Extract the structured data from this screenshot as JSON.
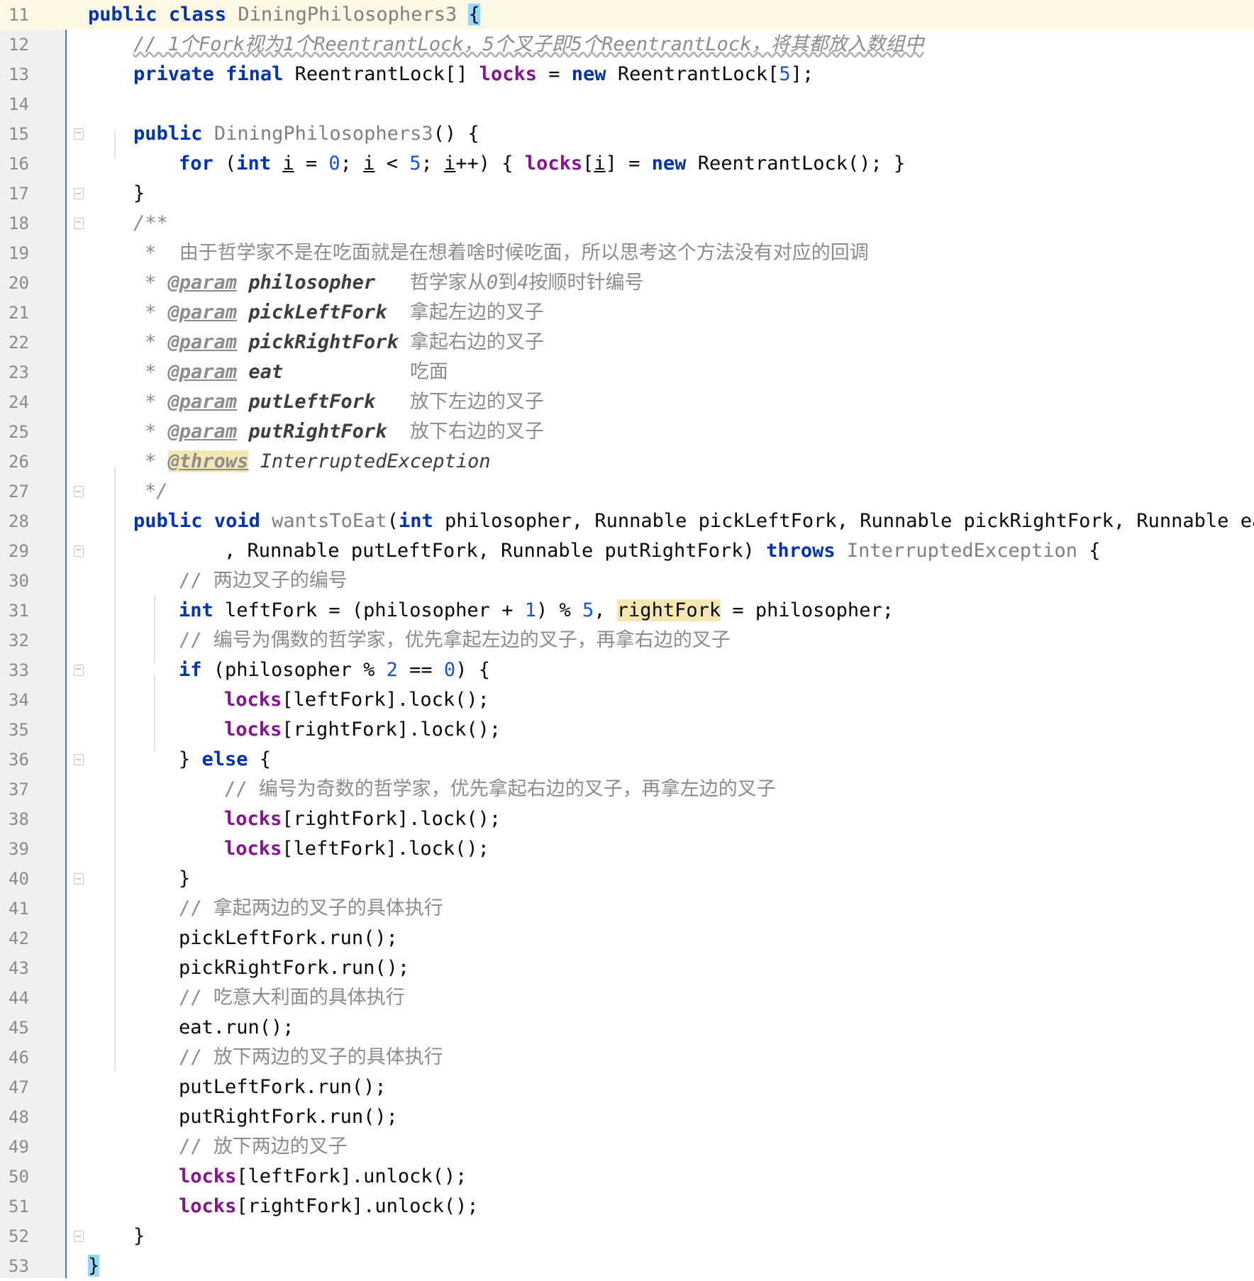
{
  "editor": {
    "language": "java",
    "current_line": 11,
    "colors": {
      "keyword": "#0033b3",
      "field": "#871094",
      "number": "#1750eb",
      "comment": "#8c8c8c",
      "highlight": "#f5e7b3",
      "brace_match": "#93d9ff",
      "gutter_border": "#4a7ab5"
    }
  },
  "lines": [
    {
      "n": "11",
      "t": "public class DiningPhilosophers3 {"
    },
    {
      "n": "12",
      "t": "// 1个Fork视为1个ReentrantLock，5个叉子即5个ReentrantLock，将其都放入数组中"
    },
    {
      "n": "13",
      "t": "private final ReentrantLock[] locks = new ReentrantLock[5];"
    },
    {
      "n": "14",
      "t": ""
    },
    {
      "n": "15",
      "t": "public DiningPhilosophers3() {"
    },
    {
      "n": "16",
      "t": "for (int i = 0; i < 5; i++) { locks[i] = new ReentrantLock(); }"
    },
    {
      "n": "17",
      "t": "}"
    },
    {
      "n": "18",
      "t": "/**"
    },
    {
      "n": "19",
      "t": "*  由于哲学家不是在吃面就是在想着啥时候吃面，所以思考这个方法没有对应的回调"
    },
    {
      "n": "20",
      "t": "* @param philosopher   哲学家从0到4按顺时针编号"
    },
    {
      "n": "21",
      "t": "* @param pickLeftFork  拿起左边的叉子"
    },
    {
      "n": "22",
      "t": "* @param pickRightFork 拿起右边的叉子"
    },
    {
      "n": "23",
      "t": "* @param eat           吃面"
    },
    {
      "n": "24",
      "t": "* @param putLeftFork   放下左边的叉子"
    },
    {
      "n": "25",
      "t": "* @param putRightFork  放下右边的叉子"
    },
    {
      "n": "26",
      "t": "* @throws InterruptedException"
    },
    {
      "n": "27",
      "t": "*/"
    },
    {
      "n": "28",
      "t": "public void wantsToEat(int philosopher, Runnable pickLeftFork, Runnable pickRightFork, Runnable eat"
    },
    {
      "n": "29",
      "t": ", Runnable putLeftFork, Runnable putRightFork) throws InterruptedException {"
    },
    {
      "n": "30",
      "t": "// 两边叉子的编号"
    },
    {
      "n": "31",
      "t": "int leftFork = (philosopher + 1) % 5, rightFork = philosopher;"
    },
    {
      "n": "32",
      "t": "// 编号为偶数的哲学家，优先拿起左边的叉子，再拿右边的叉子"
    },
    {
      "n": "33",
      "t": "if (philosopher % 2 == 0) {"
    },
    {
      "n": "34",
      "t": "locks[leftFork].lock();"
    },
    {
      "n": "35",
      "t": "locks[rightFork].lock();"
    },
    {
      "n": "36",
      "t": "} else {"
    },
    {
      "n": "37",
      "t": "// 编号为奇数的哲学家，优先拿起右边的叉子，再拿左边的叉子"
    },
    {
      "n": "38",
      "t": "locks[rightFork].lock();"
    },
    {
      "n": "39",
      "t": "locks[leftFork].lock();"
    },
    {
      "n": "40",
      "t": "}"
    },
    {
      "n": "41",
      "t": "// 拿起两边的叉子的具体执行"
    },
    {
      "n": "42",
      "t": "pickLeftFork.run();"
    },
    {
      "n": "43",
      "t": "pickRightFork.run();"
    },
    {
      "n": "44",
      "t": "// 吃意大利面的具体执行"
    },
    {
      "n": "45",
      "t": "eat.run();"
    },
    {
      "n": "46",
      "t": "// 放下两边的叉子的具体执行"
    },
    {
      "n": "47",
      "t": "putLeftFork.run();"
    },
    {
      "n": "48",
      "t": "putRightFork.run();"
    },
    {
      "n": "49",
      "t": "// 放下两边的叉子"
    },
    {
      "n": "50",
      "t": "locks[leftFork].unlock();"
    },
    {
      "n": "51",
      "t": "locks[rightFork].unlock();"
    },
    {
      "n": "52",
      "t": "}"
    },
    {
      "n": "53",
      "t": "}"
    }
  ],
  "tokens": {
    "public": "public",
    "class": "class",
    "private": "private",
    "final": "final",
    "new": "new",
    "for": "for",
    "int": "int",
    "void": "void",
    "throws": "throws",
    "if": "if",
    "else": "else",
    "cls_name": "DiningPhilosophers3",
    "lock_type": "ReentrantLock",
    "locks": "locks",
    "five": "5",
    "zero": "0",
    "one": "1",
    "two": "2",
    "i": "i",
    "method": "wantsToEat",
    "runnable": "Runnable",
    "ie": "InterruptedException",
    "philosopher": "philosopher",
    "pickLeftFork": "pickLeftFork",
    "pickRightFork": "pickRightFork",
    "eat": "eat",
    "putLeftFork": "putLeftFork",
    "putRightFork": "putRightFork",
    "leftFork": "leftFork",
    "rightFork": "rightFork",
    "param": "@param",
    "throws_tag": "@throws"
  }
}
